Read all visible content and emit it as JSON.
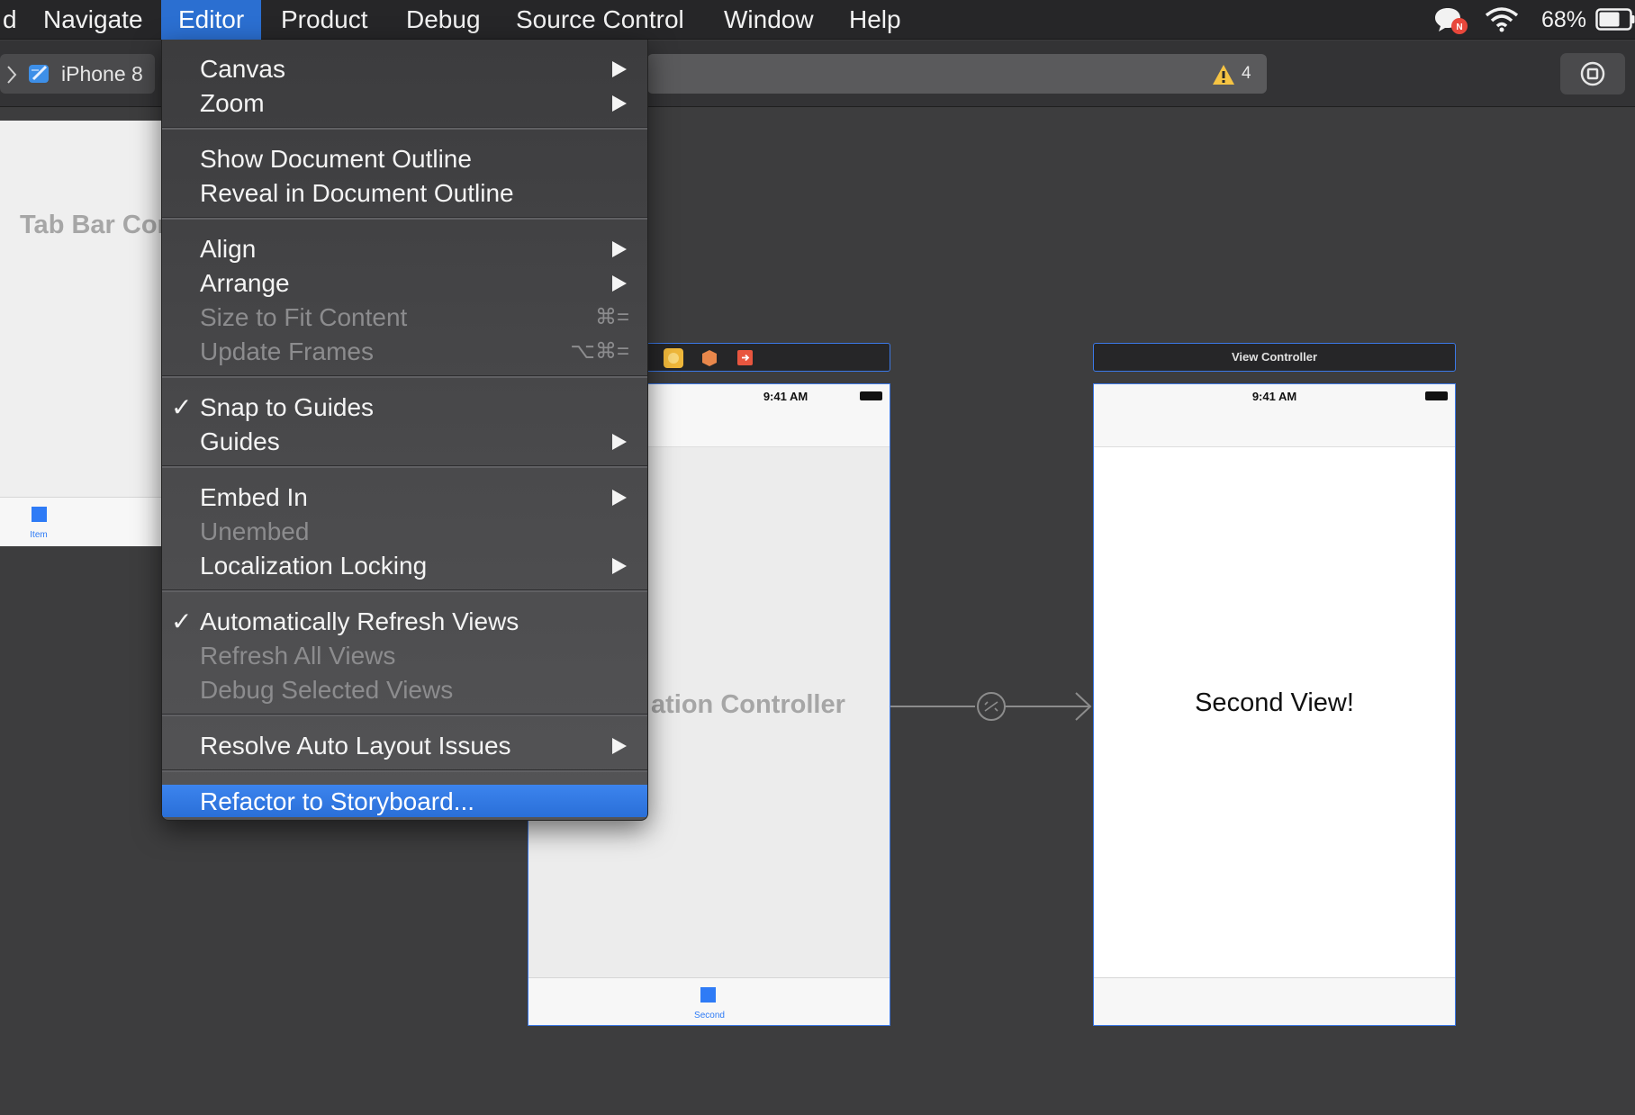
{
  "menubar": {
    "partial_left": "d",
    "items": [
      {
        "label": "Navigate"
      },
      {
        "label": "Editor"
      },
      {
        "label": "Product"
      },
      {
        "label": "Debug"
      },
      {
        "label": "Source Control"
      },
      {
        "label": "Window"
      },
      {
        "label": "Help"
      }
    ],
    "active_item": "Editor",
    "status": {
      "battery_percent": "68%",
      "icons": [
        "notification-badge-icon",
        "wifi-icon",
        "battery-icon"
      ]
    }
  },
  "toolbar": {
    "scheme": {
      "device": "iPhone 8",
      "icon": "xcode-app-icon"
    },
    "activity": {
      "warning_count": "4",
      "icon": "warning-triangle-icon"
    },
    "stop_button_icon": "stop-square-icon"
  },
  "canvas": {
    "left_scene": {
      "title": "Tab Bar Cor",
      "tab_label": "Item"
    },
    "middle_scene": {
      "header_icons": [
        "controller-icon",
        "first-responder-icon",
        "exit-icon"
      ],
      "time": "9:41 AM",
      "title": "ation Controller",
      "tab_label": "Second"
    },
    "right_scene": {
      "header": "View Controller",
      "time": "9:41 AM",
      "content": "Second View!"
    },
    "segue_icon": "segue-icon"
  },
  "editor_menu": {
    "groups": [
      [
        {
          "label": "Canvas",
          "submenu": true,
          "enabled": true
        },
        {
          "label": "Zoom",
          "submenu": true,
          "enabled": true
        }
      ],
      [
        {
          "label": "Show Document Outline",
          "enabled": true
        },
        {
          "label": "Reveal in Document Outline",
          "enabled": true
        }
      ],
      [
        {
          "label": "Align",
          "submenu": true,
          "enabled": true
        },
        {
          "label": "Arrange",
          "submenu": true,
          "enabled": true
        },
        {
          "label": "Size to Fit Content",
          "shortcut": "⌘=",
          "enabled": false
        },
        {
          "label": "Update Frames",
          "shortcut": "⌥⌘=",
          "enabled": false
        }
      ],
      [
        {
          "label": "Snap to Guides",
          "checked": true,
          "enabled": true
        },
        {
          "label": "Guides",
          "submenu": true,
          "enabled": true
        }
      ],
      [
        {
          "label": "Embed In",
          "submenu": true,
          "enabled": true
        },
        {
          "label": "Unembed",
          "enabled": false
        },
        {
          "label": "Localization Locking",
          "submenu": true,
          "enabled": true
        }
      ],
      [
        {
          "label": "Automatically Refresh Views",
          "checked": true,
          "enabled": true
        },
        {
          "label": "Refresh All Views",
          "enabled": false
        },
        {
          "label": "Debug Selected Views",
          "enabled": false
        }
      ],
      [
        {
          "label": "Resolve Auto Layout Issues",
          "submenu": true,
          "enabled": true
        }
      ],
      [
        {
          "label": "Refactor to Storyboard...",
          "enabled": true,
          "highlighted": true
        }
      ]
    ],
    "check_glyph": "✓",
    "highlight_color": "#2f78e3"
  }
}
